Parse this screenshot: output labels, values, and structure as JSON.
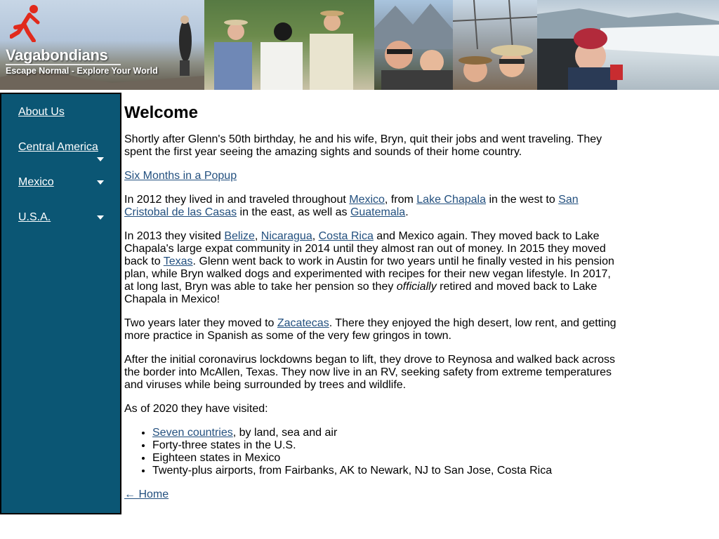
{
  "site": {
    "title": "Vagabondians",
    "tagline": "Escape Normal - Explore Your World"
  },
  "icons": {
    "logo": "running-person-icon",
    "caret": "caret-down-icon"
  },
  "colors": {
    "sidebar_bg": "#0b5674",
    "link": "#23507f",
    "logo_red": "#e12a1c"
  },
  "sidebar": {
    "items": [
      {
        "label": "About Us",
        "has_submenu": false
      },
      {
        "label": "Central America",
        "has_submenu": true
      },
      {
        "label": "Mexico",
        "has_submenu": true
      },
      {
        "label": "U.S.A.",
        "has_submenu": true
      }
    ]
  },
  "content": {
    "heading": "Welcome",
    "p1": "Shortly after Glenn's 50th birthday, he and his wife, Bryn, quit their jobs and went traveling. They spent the first year seeing the amazing sights and sounds of their home country.",
    "link_popup": "Six Months in a Popup",
    "p3": {
      "t1": "In 2012 they lived in and traveled throughout ",
      "l1": "Mexico",
      "t2": ", from ",
      "l2": "Lake Chapala",
      "t3": " in the west to ",
      "l3": "San Cristobal de las Casas",
      "t4": " in the east, as well as ",
      "l4": "Guatemala",
      "t5": "."
    },
    "p4": {
      "t1": "In 2013 they visited ",
      "l1": "Belize",
      "t2": ", ",
      "l2": "Nicaragua",
      "t3": ", ",
      "l3": "Costa Rica",
      "t4": " and Mexico again. They moved back to Lake Chapala's large expat community in 2014 until they almost ran out of money. In 2015 they moved back to ",
      "l4": "Texas",
      "t5": ". Glenn went back to work in Austin for two years until he finally vested in his pension plan, while Bryn walked dogs and experimented with recipes for their new vegan lifestyle. In 2017, at long last, Bryn was able to take her pension so they ",
      "em": "officially",
      "t6": " retired and moved back to Lake Chapala in Mexico!"
    },
    "p5": {
      "t1": "Two years later they moved to ",
      "l1": "Zacatecas",
      "t2": ". There they enjoyed the high desert, low rent, and getting more practice in Spanish as some of the very few gringos in town."
    },
    "p6": "After the initial coronavirus lockdowns began to lift, they drove to Reynosa and walked back across the border into McAllen, Texas. They now live in an RV, seeking safety from extreme temperatures and viruses while being surrounded by trees and wildlife.",
    "p7": "As of 2020 they have visited:",
    "list": {
      "item1_link": "Seven countries",
      "item1_rest": ", by land, sea and air",
      "item2": "Forty-three states in the U.S.",
      "item3": "Eighteen states in Mexico",
      "item4": "Twenty-plus airports, from Fairbanks, AK to Newark, NJ to San Jose, Costa Rica"
    },
    "home_link": "← Home"
  }
}
